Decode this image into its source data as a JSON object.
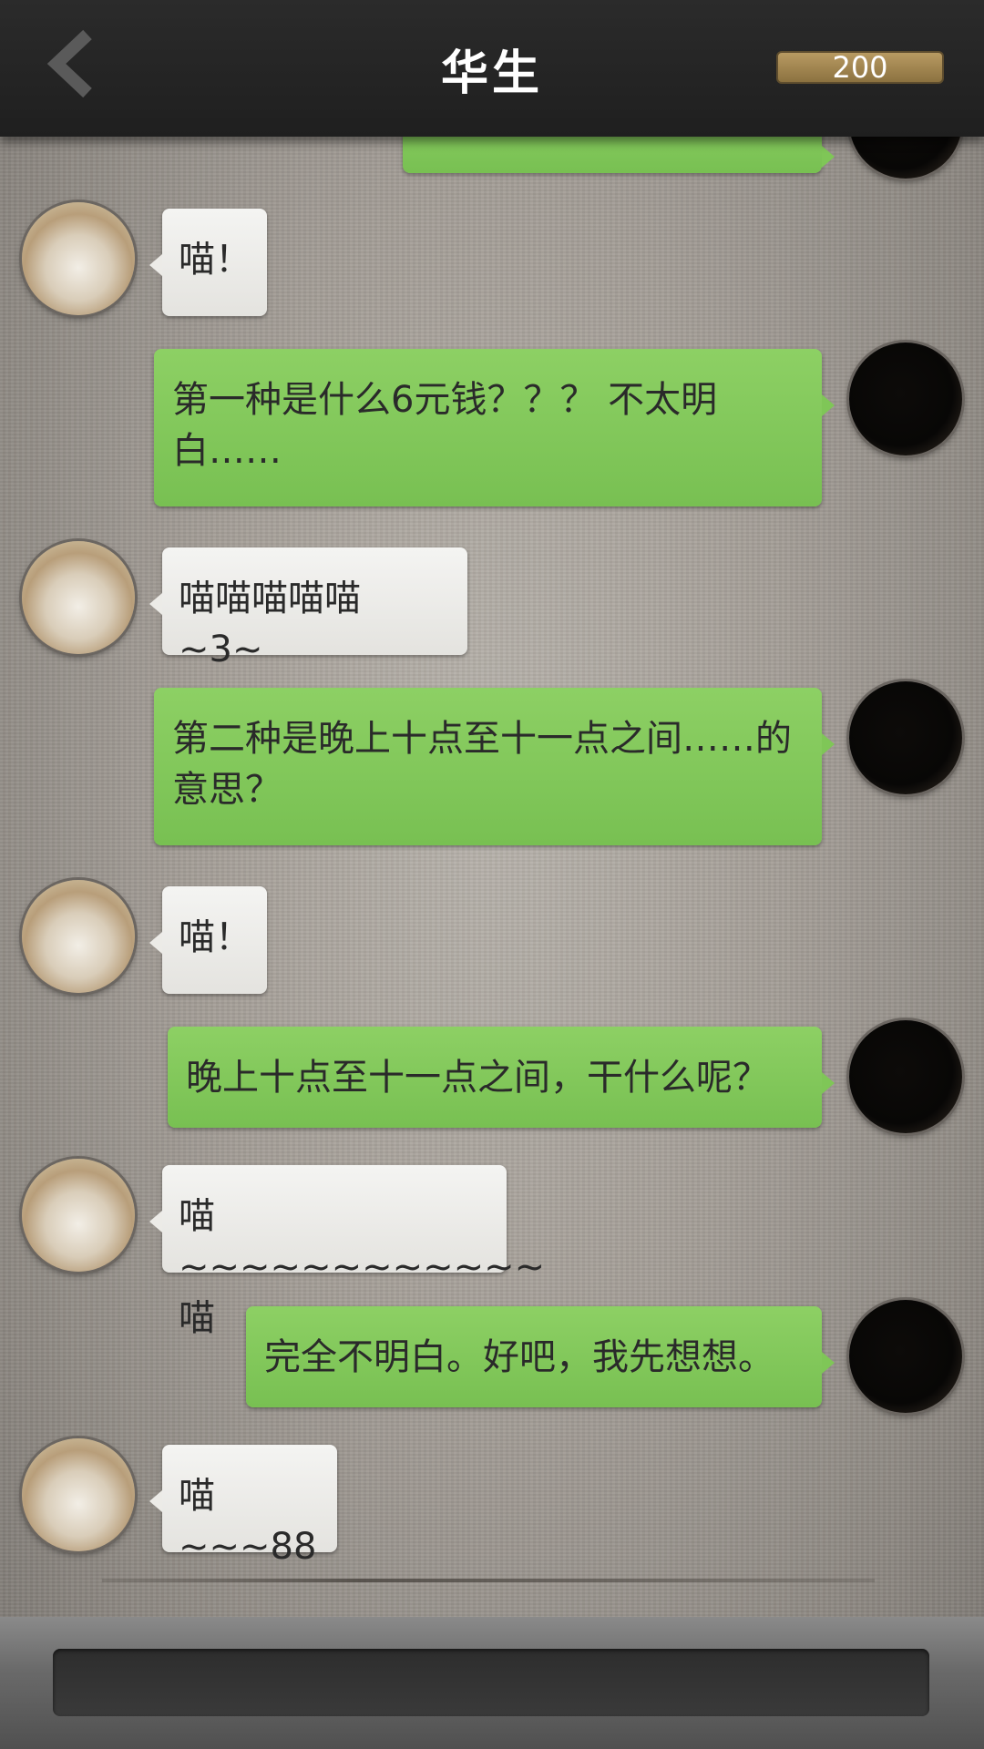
{
  "header": {
    "title": "华生",
    "coins": "200",
    "back_icon": "chevron-left-icon"
  },
  "messages": [
    {
      "from": "me",
      "text": ""
    },
    {
      "from": "cat",
      "text": "喵！"
    },
    {
      "from": "me",
      "text": "第一种是什么6元钱？？？ 不太明白……"
    },
    {
      "from": "cat",
      "text": "喵喵喵喵喵  ~3~"
    },
    {
      "from": "me",
      "text": "第二种是晚上十点至十一点之间……的意思？"
    },
    {
      "from": "cat",
      "text": "喵！"
    },
    {
      "from": "me",
      "text": "晚上十点至十一点之间，干什么呢？"
    },
    {
      "from": "cat",
      "text": "喵~~~~~~~~~~~~喵"
    },
    {
      "from": "me",
      "text": "完全不明白。好吧，我先想想。"
    },
    {
      "from": "cat",
      "text": "喵~~~88"
    }
  ],
  "input": {
    "value": ""
  }
}
